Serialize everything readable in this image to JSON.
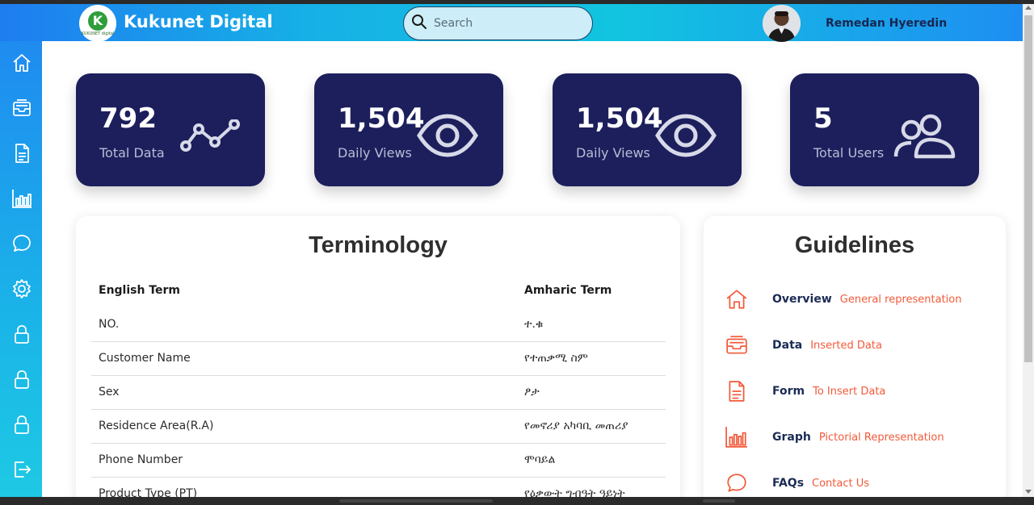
{
  "app": {
    "brand_name": "Kukunet Digital",
    "logo_letter": "K",
    "logo_subtext": "KUKUNET digital"
  },
  "search": {
    "placeholder": "Search"
  },
  "user": {
    "name": "Remedan Hyeredin"
  },
  "sidebar": {
    "items": [
      {
        "icon": "home-icon"
      },
      {
        "icon": "inbox-icon"
      },
      {
        "icon": "document-icon"
      },
      {
        "icon": "chart-icon"
      },
      {
        "icon": "chat-icon"
      },
      {
        "icon": "gear-icon"
      },
      {
        "icon": "lock-icon"
      },
      {
        "icon": "lock-icon"
      },
      {
        "icon": "lock-icon"
      },
      {
        "icon": "logout-icon"
      }
    ]
  },
  "stats": [
    {
      "value": "792",
      "label": "Total Data",
      "icon": "trend-line-icon"
    },
    {
      "value": "1,504",
      "label": "Daily Views",
      "icon": "eye-icon"
    },
    {
      "value": "1,504",
      "label": "Daily Views",
      "icon": "eye-icon"
    },
    {
      "value": "5",
      "label": "Total Users",
      "icon": "users-icon"
    }
  ],
  "terminology": {
    "title": "Terminology",
    "columns": [
      "English Term",
      "Amharic Term"
    ],
    "rows": [
      [
        "NO.",
        "ተ.ቁ"
      ],
      [
        "Customer Name",
        "የተጠቃሚ ስም"
      ],
      [
        "Sex",
        "ፆታ"
      ],
      [
        "Residence Area(R.A)",
        "የመኖሪያ አካባቢ መጠሪያ"
      ],
      [
        "Phone Number",
        "ሞባይል"
      ],
      [
        "Product Type (PT)",
        "የዕቃውት ግብዓት ዓይነት"
      ]
    ]
  },
  "guidelines": {
    "title": "Guidelines",
    "items": [
      {
        "icon": "home-icon",
        "title": "Overview",
        "desc": "General representation"
      },
      {
        "icon": "inbox-icon",
        "title": "Data",
        "desc": "Inserted Data"
      },
      {
        "icon": "document-icon",
        "title": "Form",
        "desc": "To Insert Data"
      },
      {
        "icon": "chart-icon",
        "title": "Graph",
        "desc": "Pictorial Representation"
      },
      {
        "icon": "chat-icon",
        "title": "FAQs",
        "desc": "Contact Us"
      }
    ]
  },
  "colors": {
    "card_bg": "#1c1f5c",
    "accent": "#f25a3a",
    "header_blue": "#1e7df0"
  }
}
